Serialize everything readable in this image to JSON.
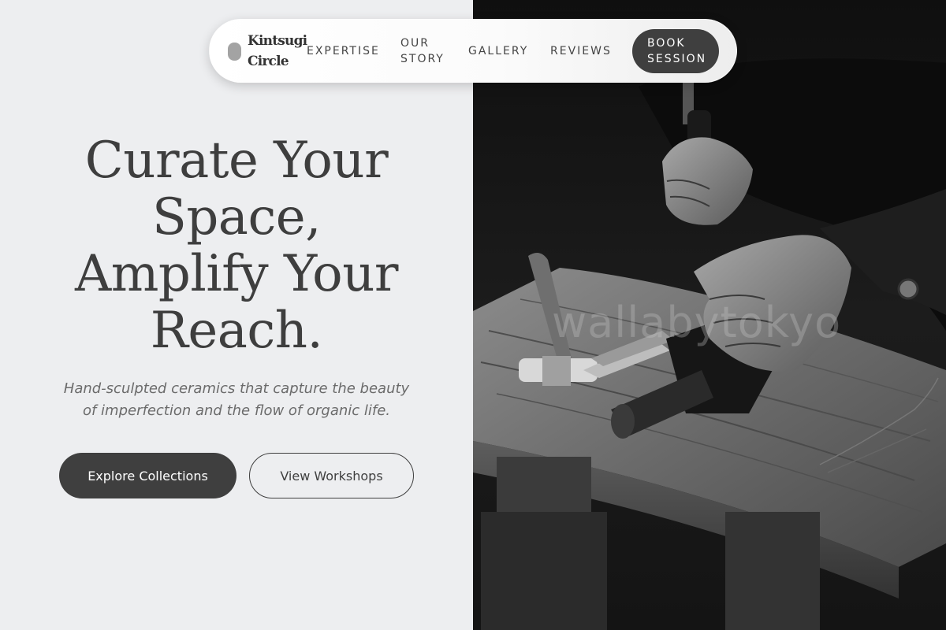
{
  "nav": {
    "logo_line1": "Kintsugi",
    "logo_line2": "Circle",
    "links": [
      {
        "label": "EXPERTISE"
      },
      {
        "label_line1": "OUR",
        "label_line2": "STORY"
      },
      {
        "label": "GALLERY"
      },
      {
        "label": "REVIEWS"
      }
    ],
    "cta_line1": "BOOK",
    "cta_line2": "SESSION"
  },
  "hero": {
    "title_lines": [
      "Curate Your",
      "Space,",
      "Amplify Your",
      "Reach."
    ],
    "subtitle_line1": "Hand-sculpted ceramics that capture the beauty",
    "subtitle_line2": "of imperfection and the flow of organic life.",
    "primary_button": "Explore Collections",
    "secondary_button": "View Workshops"
  },
  "photo": {
    "watermark": "wallabytokyo"
  },
  "colors": {
    "background": "#edeef0",
    "text_dark": "#3f3f3f",
    "button_dark": "#3f3f3f"
  }
}
